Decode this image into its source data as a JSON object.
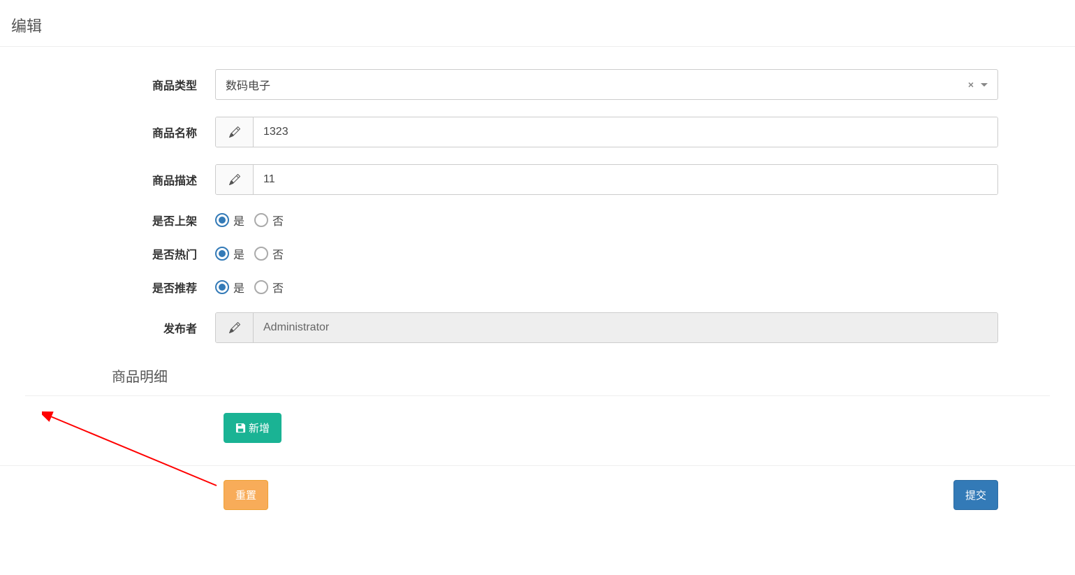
{
  "page": {
    "title": "编辑"
  },
  "form": {
    "product_type": {
      "label": "商品类型",
      "value": "数码电子",
      "clear_symbol": "×"
    },
    "product_name": {
      "label": "商品名称",
      "value": "1323"
    },
    "product_desc": {
      "label": "商品描述",
      "value": "11"
    },
    "on_shelf": {
      "label": "是否上架",
      "yes": "是",
      "no": "否",
      "selected": "yes"
    },
    "is_hot": {
      "label": "是否热门",
      "yes": "是",
      "no": "否",
      "selected": "yes"
    },
    "is_recommend": {
      "label": "是否推荐",
      "yes": "是",
      "no": "否",
      "selected": "yes"
    },
    "publisher": {
      "label": "发布者",
      "value": "Administrator"
    }
  },
  "detail_section": {
    "title": "商品明细",
    "add_button": "新增"
  },
  "footer": {
    "reset_button": "重置",
    "submit_button": "提交"
  }
}
